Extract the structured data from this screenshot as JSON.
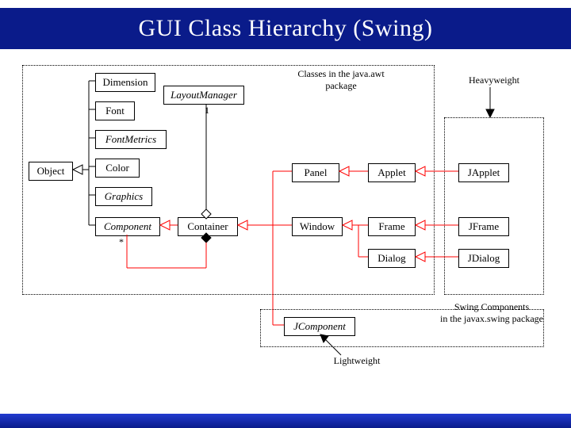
{
  "title": "GUI Class Hierarchy (Swing)",
  "labels": {
    "awt_caption": "Classes in the java.awt\npackage",
    "heavyweight": "Heavyweight",
    "lightweight": "Lightweight",
    "swing_caption": "Swing Components\nin the javax.swing package",
    "multiplicity_1": "1",
    "multiplicity_star": "*"
  },
  "boxes": {
    "object": "Object",
    "dimension": "Dimension",
    "layoutmanager": "LayoutManager",
    "font": "Font",
    "fontmetrics": "FontMetrics",
    "color": "Color",
    "graphics": "Graphics",
    "component": "Component",
    "container": "Container",
    "panel": "Panel",
    "window": "Window",
    "applet": "Applet",
    "frame": "Frame",
    "dialog": "Dialog",
    "japplet": "JApplet",
    "jframe": "JFrame",
    "jdialog": "JDialog",
    "jcomponent": "JComponent"
  }
}
